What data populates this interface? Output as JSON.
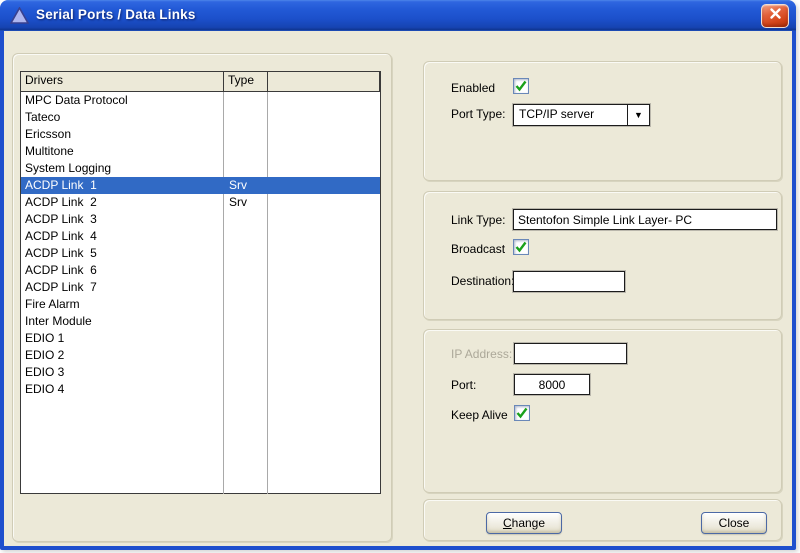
{
  "window": {
    "title": "Serial Ports / Data Links",
    "app_icon": "triangle-delta-icon",
    "close_icon": "x-mark-icon"
  },
  "list": {
    "columns": [
      "Drivers",
      "Type",
      ""
    ],
    "rows": [
      {
        "driver": "MPC Data Protocol",
        "type": "",
        "selected": false
      },
      {
        "driver": "Tateco",
        "type": "",
        "selected": false
      },
      {
        "driver": "Ericsson",
        "type": "",
        "selected": false
      },
      {
        "driver": "Multitone",
        "type": "",
        "selected": false
      },
      {
        "driver": "System Logging",
        "type": "",
        "selected": false
      },
      {
        "driver": "ACDP Link  1",
        "type": "Srv",
        "selected": true
      },
      {
        "driver": "ACDP Link  2",
        "type": "Srv",
        "selected": false
      },
      {
        "driver": "ACDP Link  3",
        "type": "",
        "selected": false
      },
      {
        "driver": "ACDP Link  4",
        "type": "",
        "selected": false
      },
      {
        "driver": "ACDP Link  5",
        "type": "",
        "selected": false
      },
      {
        "driver": "ACDP Link  6",
        "type": "",
        "selected": false
      },
      {
        "driver": "ACDP Link  7",
        "type": "",
        "selected": false
      },
      {
        "driver": "Fire Alarm",
        "type": "",
        "selected": false
      },
      {
        "driver": "Inter Module",
        "type": "",
        "selected": false
      },
      {
        "driver": "EDIO 1",
        "type": "",
        "selected": false
      },
      {
        "driver": "EDIO 2",
        "type": "",
        "selected": false
      },
      {
        "driver": "EDIO 3",
        "type": "",
        "selected": false
      },
      {
        "driver": "EDIO 4",
        "type": "",
        "selected": false
      }
    ]
  },
  "panel": {
    "enabled": {
      "label": "Enabled",
      "checked": true
    },
    "port_type": {
      "label": "Port Type:",
      "value": "TCP/IP server",
      "dropdown_icon": "caret-down"
    },
    "link_type": {
      "label": "Link Type:",
      "value": "Stentofon Simple Link Layer- PC"
    },
    "broadcast": {
      "label": "Broadcast",
      "checked": true
    },
    "destination": {
      "label": "Destination:",
      "value": ""
    },
    "ip_address": {
      "label": "IP Address:",
      "value": "",
      "disabled": true
    },
    "port": {
      "label": "Port:",
      "value": "8000"
    },
    "keep_alive": {
      "label": "Keep Alive",
      "checked": true
    }
  },
  "buttons": {
    "change": {
      "mnemonic": "C",
      "rest": "hange"
    },
    "close": {
      "label": "Close"
    }
  },
  "colors": {
    "window_border_blue": "#1e4fcd",
    "titlebar_blue": "#1f56d4",
    "client_beige": "#ece9d8",
    "selection": "#316ac5",
    "close_red": "#d34418",
    "check_green": "#1aa11a",
    "disabled_text": "#aca899"
  }
}
